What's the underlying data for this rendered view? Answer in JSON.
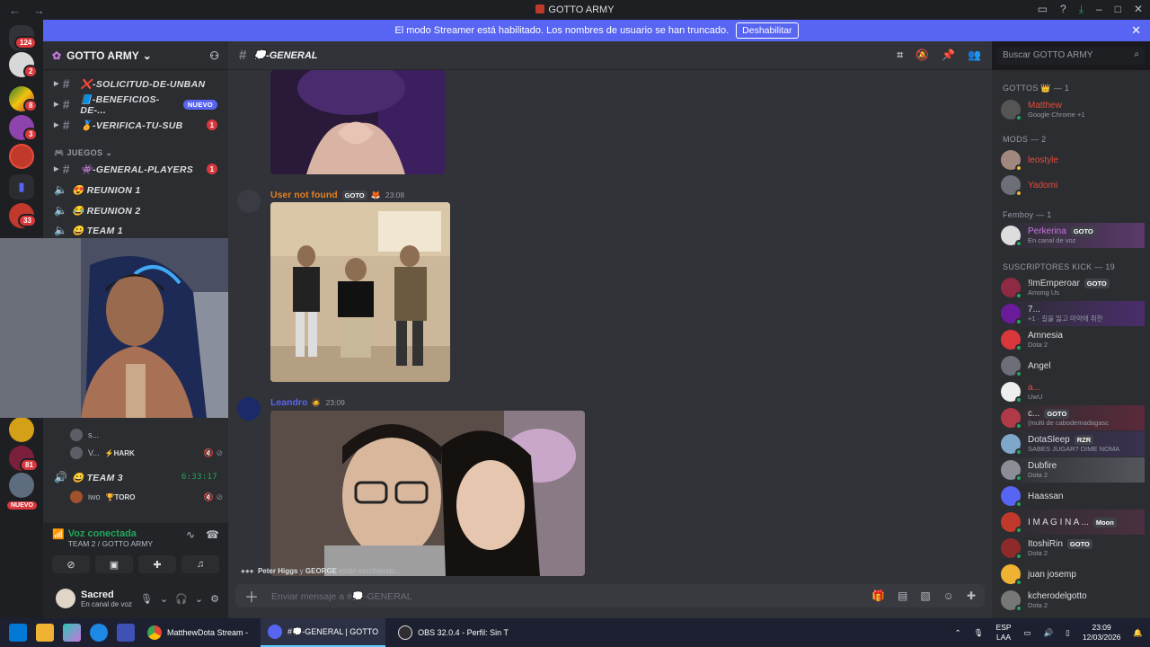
{
  "window": {
    "title": "GOTTO ARMY"
  },
  "banner": {
    "text": "El modo Streamer está habilitado. Los nombres de usuario se han truncado.",
    "button": "Deshabilitar"
  },
  "servers": {
    "dm_badge": "124",
    "badges": [
      "2",
      "8",
      "3",
      "33",
      "81"
    ],
    "new_label": "NUEVO"
  },
  "server_header": {
    "name": "GOTTO ARMY"
  },
  "channels": [
    {
      "name": "❌-SOLICITUD-DE-UNBAN",
      "type": "text"
    },
    {
      "name": "📘-BENEFICIOS-DE-...",
      "type": "text",
      "pill": "NUEVO"
    },
    {
      "name": "🏅-VERIFICA-TU-SUB",
      "type": "text",
      "count": "1"
    }
  ],
  "category_games": "JUEGOS",
  "game_channels": [
    {
      "name": "👾-GENERAL-PLAYERS",
      "type": "text",
      "count": "1"
    },
    {
      "name": "😍 REUNION 1",
      "type": "voice"
    },
    {
      "name": "😂 REUNION 2",
      "type": "voice"
    },
    {
      "name": "😀 TEAM 1",
      "type": "voice"
    }
  ],
  "voice_users": [
    {
      "name": "s...",
      "tag": ""
    },
    {
      "name": "V...",
      "tag": "⚡HARK"
    }
  ],
  "team3": {
    "name": "😀 TEAM 3",
    "timer": "6:33:17"
  },
  "team3_user": {
    "name": "iwo",
    "tag": "🏆TORO"
  },
  "voice_panel": {
    "status": "Voz conectada",
    "location": "TEAM 2 / GOTTO ARMY"
  },
  "user_panel": {
    "name": "Sacred",
    "status": "En canal de voz"
  },
  "channel_header": {
    "name": "💭-GENERAL"
  },
  "search": {
    "placeholder": "Buscar GOTTO ARMY"
  },
  "messages": [
    {
      "author": "User not found",
      "tag": "GOTO",
      "time": "23:08"
    },
    {
      "author": "Leandro",
      "time": "23:09"
    }
  ],
  "typing": {
    "users": "Peter Higgs",
    "joiner": "y",
    "user2": "GEORGE",
    "suffix": "están escribiendo..."
  },
  "composer": {
    "placeholder": "Enviar mensaje a #💭-GENERAL"
  },
  "member_groups": [
    {
      "label": "GOTTOS 👑 — 1"
    },
    {
      "label": "MODS — 2"
    },
    {
      "label": "Femboy — 1"
    },
    {
      "label": "SUSCRIPTORES KICK — 19"
    }
  ],
  "members": [
    {
      "name": "Matthew",
      "activity": "Google Chrome +1",
      "color": "#e74c3c"
    },
    {
      "name": "leostyle",
      "activity": "",
      "color": "#e74c3c"
    },
    {
      "name": "Yadomi",
      "activity": "",
      "color": "#e74c3c"
    },
    {
      "name": "Perkerina",
      "tag": "GOTO",
      "activity": "En canal de voz",
      "color": "#c678dd"
    },
    {
      "name": "!ImEmperoar",
      "tag": "GOTO",
      "activity": "Among Us",
      "color": "#dbdee1"
    },
    {
      "name": "7...",
      "activity": "+1 · 길을 잃고 마약에 취한",
      "color": "#dbdee1"
    },
    {
      "name": "Amnesia",
      "activity": "Dota 2",
      "color": "#dbdee1"
    },
    {
      "name": "Angel",
      "activity": "",
      "color": "#dbdee1"
    },
    {
      "name": "a...",
      "activity": "UwU",
      "color": "#e74c3c"
    },
    {
      "name": "c...",
      "tag": "GOTO",
      "activity": "(multi de cabodemadagasc",
      "color": "#dbdee1"
    },
    {
      "name": "DotaSleep",
      "tag": "RZR",
      "activity": "SABES JUGAR? DIME NOMA",
      "color": "#dbdee1"
    },
    {
      "name": "Dubfire",
      "activity": "Dota 2",
      "color": "#dbdee1"
    },
    {
      "name": "Haassan",
      "activity": "",
      "color": "#dbdee1"
    },
    {
      "name": "I M A G I N A ...",
      "tag": "Moon",
      "activity": "",
      "color": "#dbdee1"
    },
    {
      "name": "ItoshiRin",
      "tag": "GOTO",
      "activity": "Dota 2",
      "color": "#dbdee1"
    },
    {
      "name": "juan josemp",
      "activity": "",
      "color": "#dbdee1"
    },
    {
      "name": "kcherodelgotto",
      "activity": "Dota 2",
      "color": "#dbdee1"
    }
  ],
  "taskbar": {
    "apps": [
      {
        "label": "MatthewDota Stream - "
      },
      {
        "label": "#💭-GENERAL | GOTTO"
      },
      {
        "label": "OBS 32.0.4 - Perfil: Sin T"
      }
    ],
    "lang": "ESP",
    "lang2": "LAA",
    "time": "23:09",
    "date": "12/03/2026"
  },
  "colors": {
    "accent": "#5865f2",
    "online": "#23a55a",
    "danger": "#da373c"
  }
}
